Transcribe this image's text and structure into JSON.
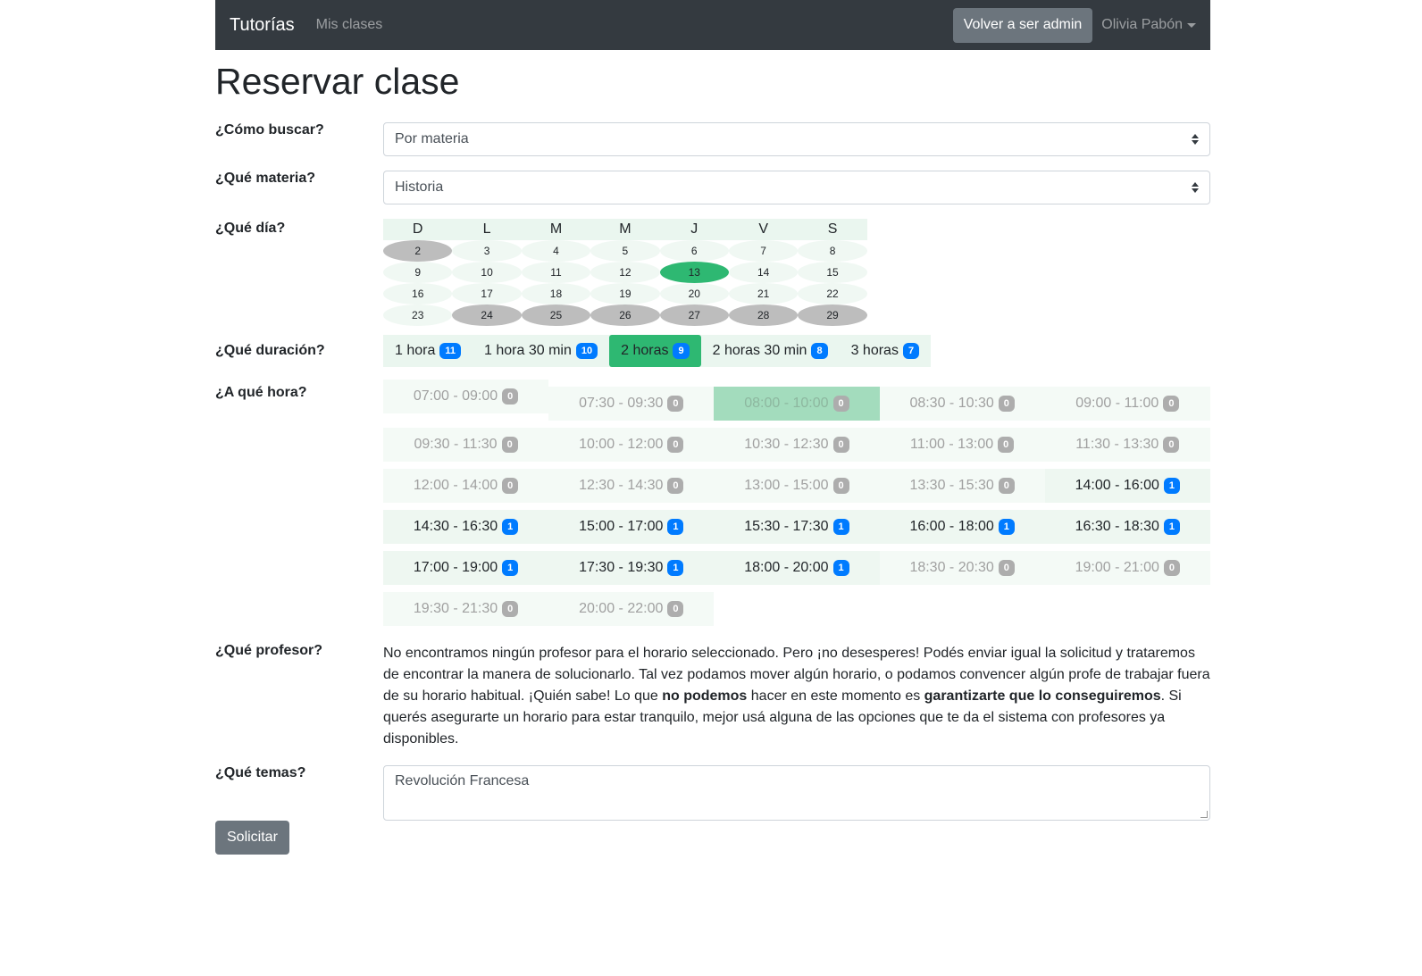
{
  "navbar": {
    "brand": "Tutorías",
    "mis_clases": "Mis clases",
    "admin_button": "Volver a ser admin",
    "user_name": "Olivia Pabón"
  },
  "page_title": "Reservar clase",
  "labels": {
    "como_buscar": "¿Cómo buscar?",
    "que_materia": "¿Qué materia?",
    "que_dia": "¿Qué día?",
    "que_duracion": "¿Qué duración?",
    "a_que_hora": "¿A qué hora?",
    "que_profesor": "¿Qué profesor?",
    "que_temas": "¿Qué temas?"
  },
  "search_mode": {
    "value": "Por materia"
  },
  "subject": {
    "value": "Historia"
  },
  "calendar": {
    "weekdays": [
      "D",
      "L",
      "M",
      "M",
      "J",
      "V",
      "S"
    ],
    "weeks": [
      [
        {
          "d": "2",
          "s": "past"
        },
        {
          "d": "3",
          "s": ""
        },
        {
          "d": "4",
          "s": ""
        },
        {
          "d": "5",
          "s": ""
        },
        {
          "d": "6",
          "s": ""
        },
        {
          "d": "7",
          "s": ""
        },
        {
          "d": "8",
          "s": ""
        }
      ],
      [
        {
          "d": "9",
          "s": ""
        },
        {
          "d": "10",
          "s": ""
        },
        {
          "d": "11",
          "s": ""
        },
        {
          "d": "12",
          "s": ""
        },
        {
          "d": "13",
          "s": "selected"
        },
        {
          "d": "14",
          "s": ""
        },
        {
          "d": "15",
          "s": ""
        }
      ],
      [
        {
          "d": "16",
          "s": ""
        },
        {
          "d": "17",
          "s": ""
        },
        {
          "d": "18",
          "s": ""
        },
        {
          "d": "19",
          "s": ""
        },
        {
          "d": "20",
          "s": ""
        },
        {
          "d": "21",
          "s": ""
        },
        {
          "d": "22",
          "s": ""
        }
      ],
      [
        {
          "d": "23",
          "s": ""
        },
        {
          "d": "24",
          "s": "past"
        },
        {
          "d": "25",
          "s": "past"
        },
        {
          "d": "26",
          "s": "past"
        },
        {
          "d": "27",
          "s": "past"
        },
        {
          "d": "28",
          "s": "past"
        },
        {
          "d": "29",
          "s": "past"
        }
      ]
    ]
  },
  "durations": [
    {
      "label": "1 hora",
      "count": "11",
      "active": false
    },
    {
      "label": "1 hora 30 min",
      "count": "10",
      "active": false
    },
    {
      "label": "2 horas",
      "count": "9",
      "active": true
    },
    {
      "label": "2 horas 30 min",
      "count": "8",
      "active": false
    },
    {
      "label": "3 horas",
      "count": "7",
      "active": false
    }
  ],
  "time_slots": [
    {
      "label": "07:00 - 09:00",
      "count": "0"
    },
    {
      "label": "07:30 - 09:30",
      "count": "0"
    },
    {
      "label": "08:00 - 10:00",
      "count": "0",
      "active": true
    },
    {
      "label": "08:30 - 10:30",
      "count": "0"
    },
    {
      "label": "09:00 - 11:00",
      "count": "0"
    },
    {
      "label": "09:30 - 11:30",
      "count": "0"
    },
    {
      "label": "10:00 - 12:00",
      "count": "0"
    },
    {
      "label": "10:30 - 12:30",
      "count": "0"
    },
    {
      "label": "11:00 - 13:00",
      "count": "0"
    },
    {
      "label": "11:30 - 13:30",
      "count": "0"
    },
    {
      "label": "12:00 - 14:00",
      "count": "0"
    },
    {
      "label": "12:30 - 14:30",
      "count": "0"
    },
    {
      "label": "13:00 - 15:00",
      "count": "0"
    },
    {
      "label": "13:30 - 15:30",
      "count": "0"
    },
    {
      "label": "14:00 - 16:00",
      "count": "1"
    },
    {
      "label": "14:30 - 16:30",
      "count": "1"
    },
    {
      "label": "15:00 - 17:00",
      "count": "1"
    },
    {
      "label": "15:30 - 17:30",
      "count": "1"
    },
    {
      "label": "16:00 - 18:00",
      "count": "1"
    },
    {
      "label": "16:30 - 18:30",
      "count": "1"
    },
    {
      "label": "17:00 - 19:00",
      "count": "1"
    },
    {
      "label": "17:30 - 19:30",
      "count": "1"
    },
    {
      "label": "18:00 - 20:00",
      "count": "1"
    },
    {
      "label": "18:30 - 20:30",
      "count": "0"
    },
    {
      "label": "19:00 - 21:00",
      "count": "0"
    },
    {
      "label": "19:30 - 21:30",
      "count": "0"
    },
    {
      "label": "20:00 - 22:00",
      "count": "0"
    }
  ],
  "professor": {
    "text_1": "No encontramos ningún profesor para el horario seleccionado. Pero ¡no desesperes! Podés enviar igual la solicitud y trataremos de encontrar la manera de solucionarlo. Tal vez podamos mover algún horario, o podamos convencer algún profe de trabajar fuera de su horario habitual. ¡Quién sabe! Lo que ",
    "bold_1": "no podemos",
    "text_2": " hacer en este momento es ",
    "bold_2": "garantizarte que lo conseguiremos",
    "text_3": ". Si querés asegurarte un horario para estar tranquilo, mejor usá alguna de las opciones que te da el sistema con profesores ya disponibles."
  },
  "topics": {
    "value": "Revolución Francesa"
  },
  "submit_label": "Solicitar",
  "colors": {
    "navbar": "#343a40",
    "accent_green": "#2eb872",
    "badge_blue": "#007bff",
    "badge_gray": "#adadad",
    "button_gray": "#6c757d"
  }
}
